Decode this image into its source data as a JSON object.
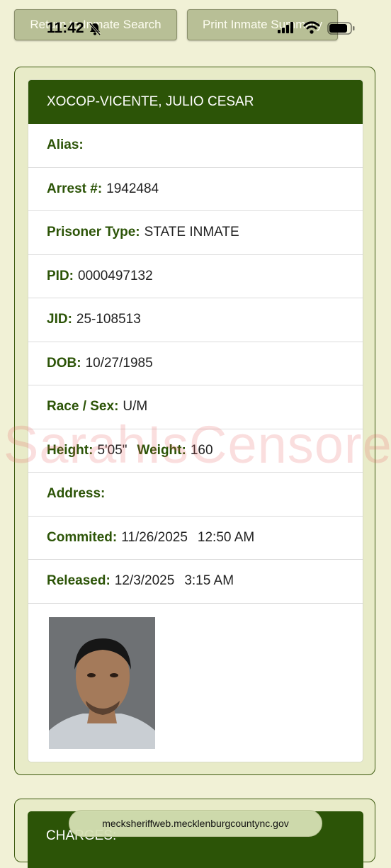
{
  "toolbar": {
    "return_label": "Return to Inmate Search",
    "print_label": "Print Inmate Summary"
  },
  "status_bar": {
    "time": "11:42",
    "icons": [
      "bell-slash-icon",
      "cellular-signal-icon",
      "wifi-icon",
      "battery-icon"
    ]
  },
  "inmate": {
    "name": "XOCOP-VICENTE, JULIO CESAR",
    "alias_label": "Alias:",
    "alias": "",
    "arrest_label": "Arrest #:",
    "arrest": "1942484",
    "prisoner_type_label": "Prisoner Type:",
    "prisoner_type": "STATE INMATE",
    "pid_label": "PID:",
    "pid": "0000497132",
    "jid_label": "JID:",
    "jid": "25-108513",
    "dob_label": "DOB:",
    "dob": "10/27/1985",
    "race_sex_label": "Race / Sex:",
    "race_sex": "U/M",
    "height_label": "Height:",
    "height": "5'05\"",
    "weight_label": "Weight:",
    "weight": "160",
    "address_label": "Address:",
    "address": "",
    "committed_label": "Commited:",
    "committed_date": "11/26/2025",
    "committed_time": "12:50 AM",
    "released_label": "Released:",
    "released_date": "12/3/2025",
    "released_time": "3:15 AM"
  },
  "charges": {
    "heading": "CHARGES:"
  },
  "watermark": "SarahIsCensored",
  "browser": {
    "url": "mecksheriffweb.mecklenburgcountync.gov"
  },
  "colors": {
    "page_bg": "#f1f1d6",
    "header_green": "#2c5407",
    "label_green": "#2c5407",
    "button_bg": "#b8bf96"
  }
}
